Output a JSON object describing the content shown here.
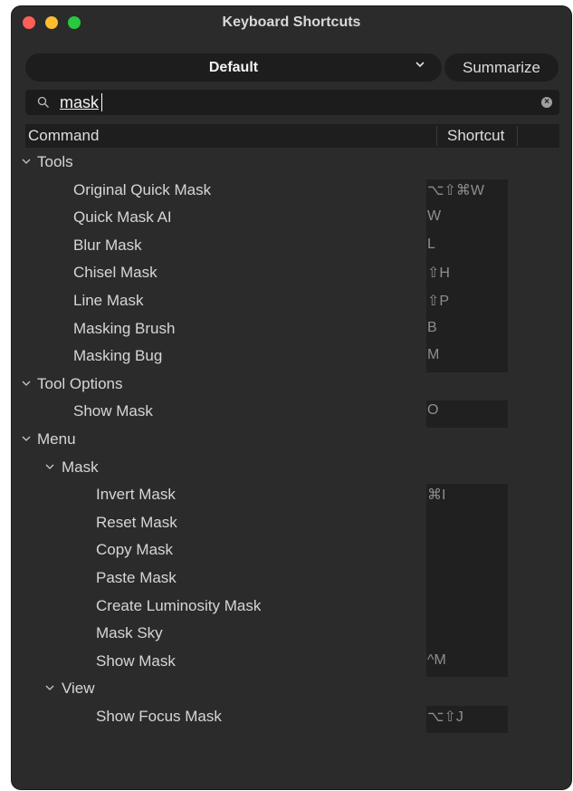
{
  "window": {
    "title": "Keyboard Shortcuts"
  },
  "toolbar": {
    "preset_value": "Default",
    "summarize_label": "Summarize"
  },
  "search": {
    "value": "mask"
  },
  "table": {
    "col_command": "Command",
    "col_shortcut": "Shortcut"
  },
  "rows": [
    {
      "type": "group",
      "level": 0,
      "label": "Tools"
    },
    {
      "type": "item",
      "level": 1,
      "label": "Original Quick Mask",
      "shortcut": "⌥⇧⌘W"
    },
    {
      "type": "item",
      "level": 1,
      "label": "Quick Mask AI",
      "shortcut": "W"
    },
    {
      "type": "item",
      "level": 1,
      "label": "Blur Mask",
      "shortcut": "L"
    },
    {
      "type": "item",
      "level": 1,
      "label": "Chisel Mask",
      "shortcut": "⇧H"
    },
    {
      "type": "item",
      "level": 1,
      "label": "Line Mask",
      "shortcut": "⇧P"
    },
    {
      "type": "item",
      "level": 1,
      "label": "Masking Brush",
      "shortcut": "B"
    },
    {
      "type": "item",
      "level": 1,
      "label": "Masking Bug",
      "shortcut": "M"
    },
    {
      "type": "group",
      "level": 0,
      "label": "Tool Options"
    },
    {
      "type": "item",
      "level": 1,
      "label": "Show Mask",
      "shortcut": "O"
    },
    {
      "type": "group",
      "level": 0,
      "label": "Menu"
    },
    {
      "type": "group",
      "level": 1,
      "label": "Mask"
    },
    {
      "type": "item",
      "level": 2,
      "label": "Invert Mask",
      "shortcut": "⌘I"
    },
    {
      "type": "item",
      "level": 2,
      "label": "Reset Mask",
      "shortcut": ""
    },
    {
      "type": "item",
      "level": 2,
      "label": "Copy Mask",
      "shortcut": ""
    },
    {
      "type": "item",
      "level": 2,
      "label": "Paste Mask",
      "shortcut": ""
    },
    {
      "type": "item",
      "level": 2,
      "label": "Create Luminosity Mask",
      "shortcut": ""
    },
    {
      "type": "item",
      "level": 2,
      "label": "Mask Sky",
      "shortcut": ""
    },
    {
      "type": "item",
      "level": 2,
      "label": "Show Mask",
      "shortcut": "^M"
    },
    {
      "type": "group",
      "level": 1,
      "label": "View"
    },
    {
      "type": "item",
      "level": 2,
      "label": "Show Focus Mask",
      "shortcut": "⌥⇧J"
    }
  ]
}
